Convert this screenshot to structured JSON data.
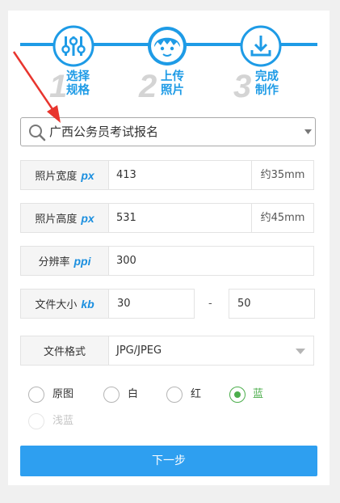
{
  "steps": [
    {
      "num": "1",
      "line1": "选择",
      "line2": "规格"
    },
    {
      "num": "2",
      "line1": "上传",
      "line2": "照片"
    },
    {
      "num": "3",
      "line1": "完成",
      "line2": "制作"
    }
  ],
  "search": {
    "value": "广西公务员考试报名"
  },
  "width_row": {
    "label": "照片宽度",
    "unit": "px",
    "value": "413",
    "suffix": "约35mm"
  },
  "height_row": {
    "label": "照片高度",
    "unit": "px",
    "value": "531",
    "suffix": "约45mm"
  },
  "dpi_row": {
    "label": "分辨率",
    "unit": "ppi",
    "value": "300"
  },
  "size_row": {
    "label": "文件大小",
    "unit": "kb",
    "min": "30",
    "separator": "-",
    "max": "50"
  },
  "format_row": {
    "label": "文件格式",
    "value": "JPG/JPEG"
  },
  "background_options": {
    "options": [
      {
        "label": "原图",
        "selected": false,
        "disabled": false
      },
      {
        "label": "白",
        "selected": false,
        "disabled": false
      },
      {
        "label": "红",
        "selected": false,
        "disabled": false
      },
      {
        "label": "蓝",
        "selected": true,
        "disabled": false
      },
      {
        "label": "浅蓝",
        "selected": false,
        "disabled": true
      }
    ]
  },
  "next_button": {
    "label": "下一步"
  },
  "colors": {
    "accent": "#1e9be6",
    "button": "#2e9ff0",
    "selected": "#4cae4c",
    "arrow": "#e8352e"
  }
}
